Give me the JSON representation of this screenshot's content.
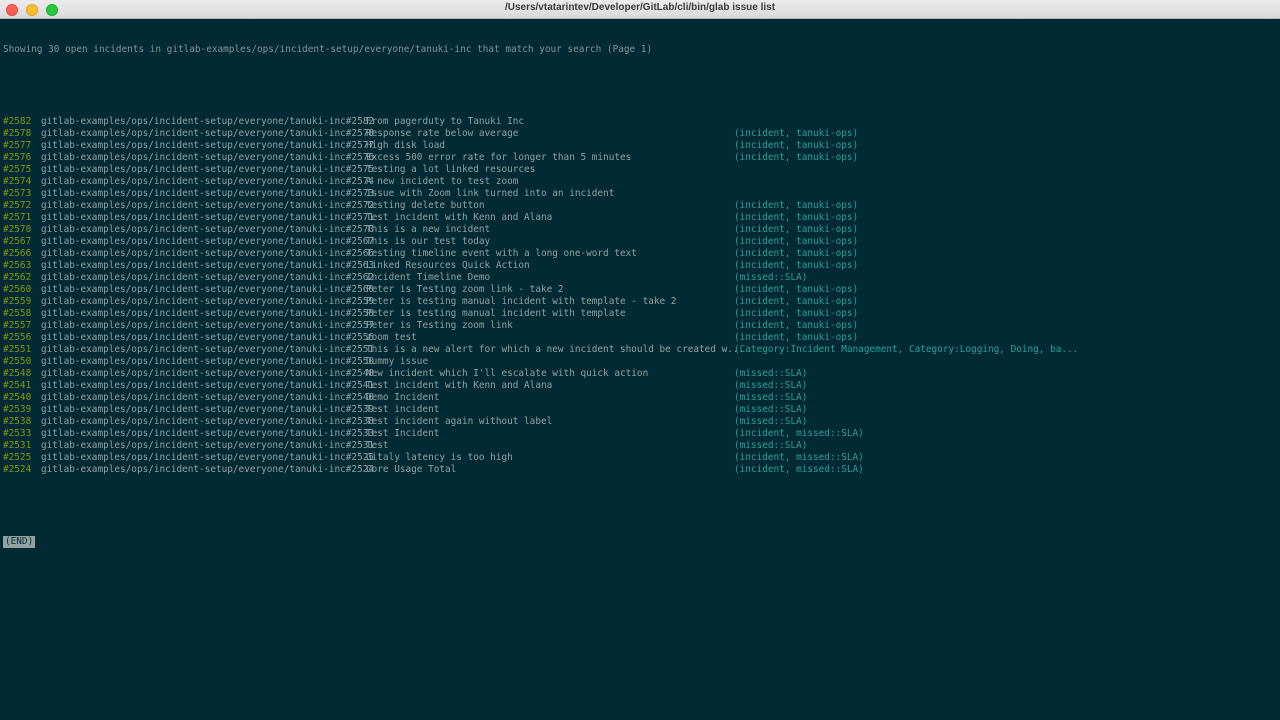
{
  "window": {
    "title": "/Users/vtatarintev/Developer/GitLab/cli/bin/glab issue list"
  },
  "terminal": {
    "summary": "Showing 30 open incidents in gitlab-examples/ops/incident-setup/everyone/tanuki-inc that match your search (Page 1)",
    "pager_end": "(END)",
    "issues": [
      {
        "num": "#2582",
        "ref": "gitlab-examples/ops/incident-setup/everyone/tanuki-inc#2582",
        "title": "From pagerduty to Tanuki Inc",
        "labels": ""
      },
      {
        "num": "#2578",
        "ref": "gitlab-examples/ops/incident-setup/everyone/tanuki-inc#2578",
        "title": "Response rate below average",
        "labels": "(incident, tanuki-ops)"
      },
      {
        "num": "#2577",
        "ref": "gitlab-examples/ops/incident-setup/everyone/tanuki-inc#2577",
        "title": "High disk load",
        "labels": "(incident, tanuki-ops)"
      },
      {
        "num": "#2576",
        "ref": "gitlab-examples/ops/incident-setup/everyone/tanuki-inc#2576",
        "title": "Excess 500 error rate for longer than 5 minutes",
        "labels": "(incident, tanuki-ops)"
      },
      {
        "num": "#2575",
        "ref": "gitlab-examples/ops/incident-setup/everyone/tanuki-inc#2575",
        "title": "Testing a lot linked resources",
        "labels": ""
      },
      {
        "num": "#2574",
        "ref": "gitlab-examples/ops/incident-setup/everyone/tanuki-inc#2574",
        "title": "A new incident to test zoom",
        "labels": ""
      },
      {
        "num": "#2573",
        "ref": "gitlab-examples/ops/incident-setup/everyone/tanuki-inc#2573",
        "title": "Issue with Zoom link turned into an incident",
        "labels": ""
      },
      {
        "num": "#2572",
        "ref": "gitlab-examples/ops/incident-setup/everyone/tanuki-inc#2572",
        "title": "testing delete button",
        "labels": "(incident, tanuki-ops)"
      },
      {
        "num": "#2571",
        "ref": "gitlab-examples/ops/incident-setup/everyone/tanuki-inc#2571",
        "title": "Test incident with Kenn and Alana",
        "labels": "(incident, tanuki-ops)"
      },
      {
        "num": "#2570",
        "ref": "gitlab-examples/ops/incident-setup/everyone/tanuki-inc#2570",
        "title": "This is a new incident",
        "labels": "(incident, tanuki-ops)"
      },
      {
        "num": "#2567",
        "ref": "gitlab-examples/ops/incident-setup/everyone/tanuki-inc#2567",
        "title": "This is our test today",
        "labels": "(incident, tanuki-ops)"
      },
      {
        "num": "#2566",
        "ref": "gitlab-examples/ops/incident-setup/everyone/tanuki-inc#2566",
        "title": "Testing timeline event with a long one-word text",
        "labels": "(incident, tanuki-ops)"
      },
      {
        "num": "#2563",
        "ref": "gitlab-examples/ops/incident-setup/everyone/tanuki-inc#2563",
        "title": "Linked Resources Quick Action",
        "labels": "(incident, tanuki-ops)"
      },
      {
        "num": "#2562",
        "ref": "gitlab-examples/ops/incident-setup/everyone/tanuki-inc#2562",
        "title": "Incident Timeline Demo",
        "labels": "(missed::SLA)"
      },
      {
        "num": "#2560",
        "ref": "gitlab-examples/ops/incident-setup/everyone/tanuki-inc#2560",
        "title": "Peter is Testing zoom link - take 2",
        "labels": "(incident, tanuki-ops)"
      },
      {
        "num": "#2559",
        "ref": "gitlab-examples/ops/incident-setup/everyone/tanuki-inc#2559",
        "title": "Peter is testing manual incident with template - take 2",
        "labels": "(incident, tanuki-ops)"
      },
      {
        "num": "#2558",
        "ref": "gitlab-examples/ops/incident-setup/everyone/tanuki-inc#2558",
        "title": "Peter is testing manual incident with template",
        "labels": "(incident, tanuki-ops)"
      },
      {
        "num": "#2557",
        "ref": "gitlab-examples/ops/incident-setup/everyone/tanuki-inc#2557",
        "title": "Peter is Testing zoom link",
        "labels": "(incident, tanuki-ops)"
      },
      {
        "num": "#2556",
        "ref": "gitlab-examples/ops/incident-setup/everyone/tanuki-inc#2556",
        "title": "zoom test",
        "labels": "(incident, tanuki-ops)"
      },
      {
        "num": "#2551",
        "ref": "gitlab-examples/ops/incident-setup/everyone/tanuki-inc#2551",
        "title": "This is a new alert for which a new incident should be created w...",
        "labels": "(Category:Incident Management, Category:Logging, Doing, ba..."
      },
      {
        "num": "#2550",
        "ref": "gitlab-examples/ops/incident-setup/everyone/tanuki-inc#2550",
        "title": "Dummy issue",
        "labels": ""
      },
      {
        "num": "#2548",
        "ref": "gitlab-examples/ops/incident-setup/everyone/tanuki-inc#2548",
        "title": "New incident which I'll escalate with quick action",
        "labels": "(missed::SLA)"
      },
      {
        "num": "#2541",
        "ref": "gitlab-examples/ops/incident-setup/everyone/tanuki-inc#2541",
        "title": "Test incident with Kenn and Alana",
        "labels": "(missed::SLA)"
      },
      {
        "num": "#2540",
        "ref": "gitlab-examples/ops/incident-setup/everyone/tanuki-inc#2540",
        "title": "Demo Incident",
        "labels": "(missed::SLA)"
      },
      {
        "num": "#2539",
        "ref": "gitlab-examples/ops/incident-setup/everyone/tanuki-inc#2539",
        "title": "Test incident",
        "labels": "(missed::SLA)"
      },
      {
        "num": "#2538",
        "ref": "gitlab-examples/ops/incident-setup/everyone/tanuki-inc#2538",
        "title": "Test incident again without label",
        "labels": "(missed::SLA)"
      },
      {
        "num": "#2533",
        "ref": "gitlab-examples/ops/incident-setup/everyone/tanuki-inc#2533",
        "title": "Test Incident",
        "labels": "(incident, missed::SLA)"
      },
      {
        "num": "#2531",
        "ref": "gitlab-examples/ops/incident-setup/everyone/tanuki-inc#2531",
        "title": "Test",
        "labels": "(missed::SLA)"
      },
      {
        "num": "#2525",
        "ref": "gitlab-examples/ops/incident-setup/everyone/tanuki-inc#2525",
        "title": "Gitaly latency is too high",
        "labels": "(incident, missed::SLA)"
      },
      {
        "num": "#2524",
        "ref": "gitlab-examples/ops/incident-setup/everyone/tanuki-inc#2524",
        "title": "Core Usage Total",
        "labels": "(incident, missed::SLA)"
      }
    ]
  }
}
